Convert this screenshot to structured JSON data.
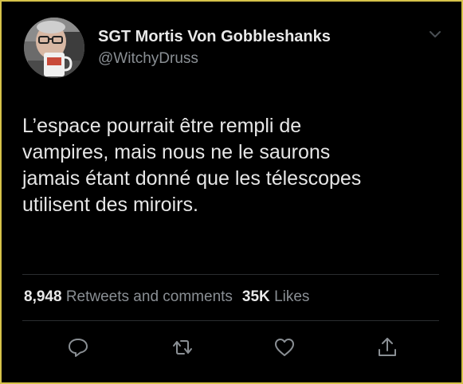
{
  "tweet": {
    "display_name": "SGT Mortis Von Gobbleshanks",
    "handle": "@WitchyDruss",
    "text": "L’espace pourrait être rempli de\nvampires, mais nous ne le saurons\njamais étant donné que les télescopes\nutilisent des miroirs.",
    "retweets_count": "8,948",
    "retweets_label": "Retweets and comments",
    "likes_count": "35K",
    "likes_label": "Likes"
  },
  "icons": {
    "more": "chevron-down-icon",
    "reply": "reply-icon",
    "retweet": "retweet-icon",
    "like": "heart-icon",
    "share": "share-icon"
  },
  "colors": {
    "background": "#000000",
    "border": "#d6c34a",
    "text": "#e6e6e6",
    "secondary_text": "#8a8f94",
    "divider": "#2a2d30",
    "icon": "#8a8f94"
  }
}
